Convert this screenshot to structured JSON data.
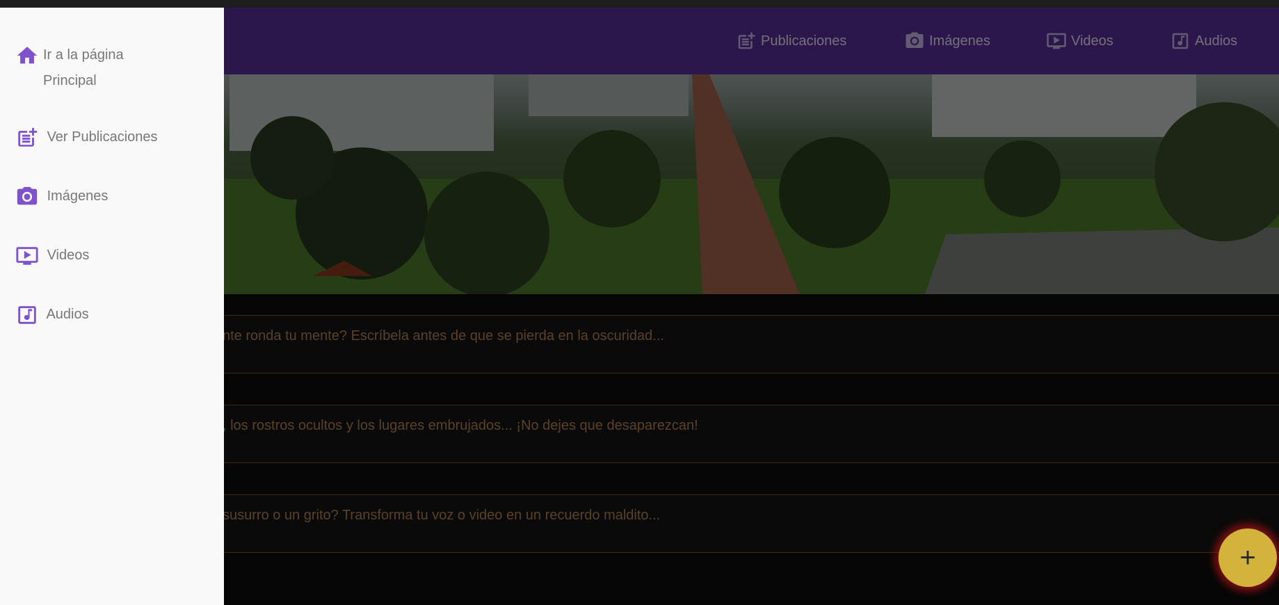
{
  "appbar": {
    "nav": [
      {
        "label": "Publicaciones",
        "icon": "post-add-icon"
      },
      {
        "label": "Imágenes",
        "icon": "camera-icon"
      },
      {
        "label": "Videos",
        "icon": "video-icon"
      },
      {
        "label": "Audios",
        "icon": "music-note-icon"
      }
    ]
  },
  "hero": {
    "alt": "campus-landscape"
  },
  "prompts": [
    {
      "text": "nte ronda tu mente? Escríbela antes de que se pierda en la oscuridad..."
    },
    {
      "text": ", los rostros ocultos y los lugares embrujados... ¡No dejes que desaparezcan!"
    },
    {
      "text": " susurro o un grito? Transforma tu voz o video en un recuerdo maldito..."
    }
  ],
  "fab": {
    "label": "+"
  },
  "drawer": {
    "items": [
      {
        "label": "Ir a la página Principal",
        "icon": "home-icon"
      },
      {
        "label": "Ver Publicaciones",
        "icon": "post-add-icon"
      },
      {
        "label": "Imágenes",
        "icon": "camera-icon"
      },
      {
        "label": "Videos",
        "icon": "video-icon"
      },
      {
        "label": "Audios",
        "icon": "music-note-icon"
      }
    ]
  },
  "colors": {
    "appbar": "#572e98",
    "drawer_bg": "#f9f9f9",
    "drawer_icon": "#7f52cc",
    "prompt_text": "#b5834d",
    "fab": "#d3b33b",
    "fab_glow": "#b01414"
  }
}
